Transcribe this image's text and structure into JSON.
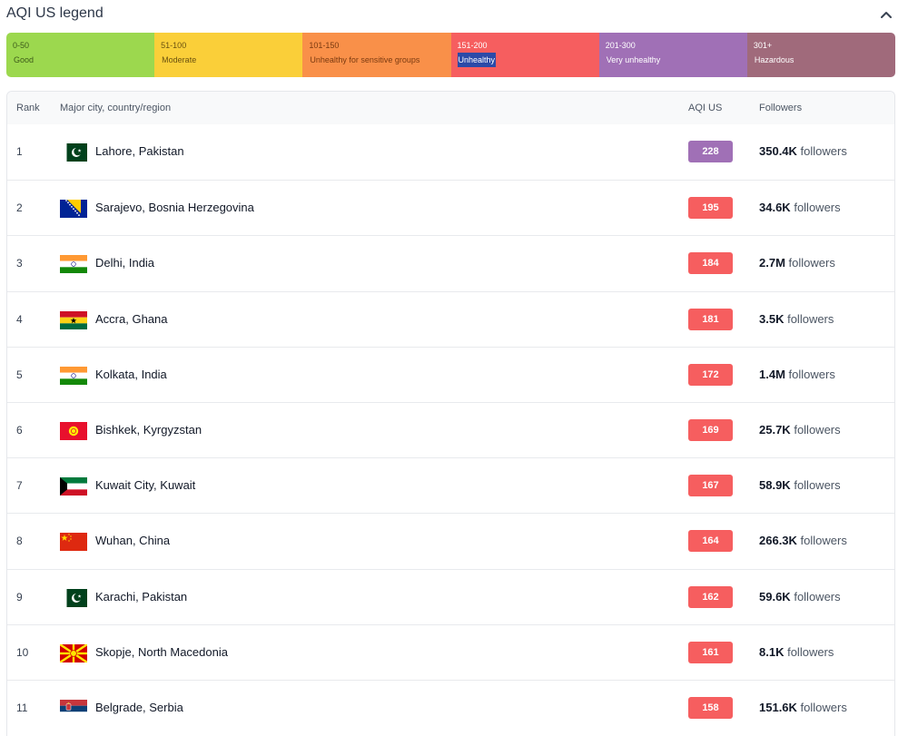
{
  "legend": {
    "title": "AQI US legend",
    "collapse_icon": "chevron-up-icon",
    "segments": [
      {
        "range": "0-50",
        "label": "Good",
        "color": "#9cd84e",
        "text_color": "#3d5a1a"
      },
      {
        "range": "51-100",
        "label": "Moderate",
        "color": "#facf39",
        "text_color": "#6b5210"
      },
      {
        "range": "101-150",
        "label": "Unhealthy for sensitive groups",
        "color": "#f99049",
        "text_color": "#7a3a10"
      },
      {
        "range": "151-200",
        "label": "Unhealthy",
        "color": "#f65e5f",
        "text_color": "#ffffff",
        "selected": true
      },
      {
        "range": "201-300",
        "label": "Very unhealthy",
        "color": "#a070b6",
        "text_color": "#ffffff"
      },
      {
        "range": "301+",
        "label": "Hazardous",
        "color": "#a06a7b",
        "text_color": "#ffffff"
      }
    ]
  },
  "table": {
    "headers": {
      "rank": "Rank",
      "city": "Major city, country/region",
      "aqi": "AQI US",
      "followers": "Followers"
    },
    "rows": [
      {
        "rank": "1",
        "flag": "pakistan-flag",
        "city": "Lahore, Pakistan",
        "aqi": "228",
        "aqi_color": "#a070b6",
        "followers_num": "350.4K",
        "followers_suffix": "followers"
      },
      {
        "rank": "2",
        "flag": "bosnia-flag",
        "city": "Sarajevo, Bosnia Herzegovina",
        "aqi": "195",
        "aqi_color": "#f65e5f",
        "followers_num": "34.6K",
        "followers_suffix": "followers"
      },
      {
        "rank": "3",
        "flag": "india-flag",
        "city": "Delhi, India",
        "aqi": "184",
        "aqi_color": "#f65e5f",
        "followers_num": "2.7M",
        "followers_suffix": "followers"
      },
      {
        "rank": "4",
        "flag": "ghana-flag",
        "city": "Accra, Ghana",
        "aqi": "181",
        "aqi_color": "#f65e5f",
        "followers_num": "3.5K",
        "followers_suffix": "followers"
      },
      {
        "rank": "5",
        "flag": "india-flag",
        "city": "Kolkata, India",
        "aqi": "172",
        "aqi_color": "#f65e5f",
        "followers_num": "1.4M",
        "followers_suffix": "followers"
      },
      {
        "rank": "6",
        "flag": "kyrgyzstan-flag",
        "city": "Bishkek, Kyrgyzstan",
        "aqi": "169",
        "aqi_color": "#f65e5f",
        "followers_num": "25.7K",
        "followers_suffix": "followers"
      },
      {
        "rank": "7",
        "flag": "kuwait-flag",
        "city": "Kuwait City, Kuwait",
        "aqi": "167",
        "aqi_color": "#f65e5f",
        "followers_num": "58.9K",
        "followers_suffix": "followers"
      },
      {
        "rank": "8",
        "flag": "china-flag",
        "city": "Wuhan, China",
        "aqi": "164",
        "aqi_color": "#f65e5f",
        "followers_num": "266.3K",
        "followers_suffix": "followers"
      },
      {
        "rank": "9",
        "flag": "pakistan-flag",
        "city": "Karachi, Pakistan",
        "aqi": "162",
        "aqi_color": "#f65e5f",
        "followers_num": "59.6K",
        "followers_suffix": "followers"
      },
      {
        "rank": "10",
        "flag": "north-macedonia-flag",
        "city": "Skopje, North Macedonia",
        "aqi": "161",
        "aqi_color": "#f65e5f",
        "followers_num": "8.1K",
        "followers_suffix": "followers"
      },
      {
        "rank": "11",
        "flag": "serbia-flag",
        "city": "Belgrade, Serbia",
        "aqi": "158",
        "aqi_color": "#f65e5f",
        "followers_num": "151.6K",
        "followers_suffix": "followers"
      }
    ]
  }
}
